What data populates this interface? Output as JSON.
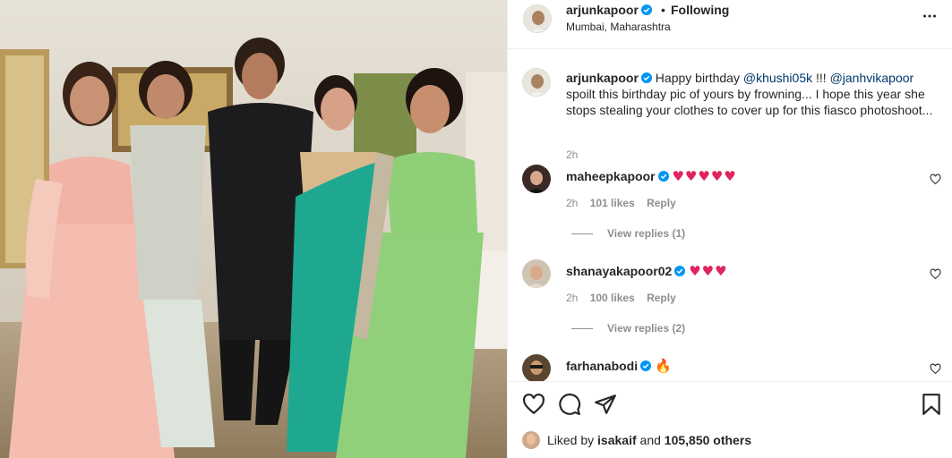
{
  "post": {
    "author": "arjunkapoor",
    "follow_status": "Following",
    "separator": "•",
    "location": "Mumbai, Maharashtra",
    "caption": {
      "username": "arjunkapoor",
      "part1": "Happy birthday ",
      "mention1": "@khushi05k",
      "part2": " !!! ",
      "mention2": "@janhvikapoor",
      "line2": "spoilt this birthday pic of yours by frowning... I hope this year she",
      "line3": "stops stealing your clothes to cover up for this fiasco photoshoot...",
      "time": "2h"
    }
  },
  "comments": [
    {
      "username": "maheepkapoor",
      "emoji": "♥♥♥♥♥",
      "time": "2h",
      "likes": "101 likes",
      "reply": "Reply",
      "replies": "View replies (1)"
    },
    {
      "username": "shanayakapoor02",
      "emoji": "♥♥♥",
      "time": "2h",
      "likes": "100 likes",
      "reply": "Reply",
      "replies": "View replies (2)"
    },
    {
      "username": "farhanabodi",
      "emoji": "🔥"
    }
  ],
  "likes": {
    "prefix": "Liked by ",
    "user": "isakaif",
    "mid": " and ",
    "count": "105,850 others"
  },
  "colors": {
    "text": "#262626",
    "secondary": "#8e8e8e",
    "mention": "#00376b",
    "verified": "#0095f6",
    "heart": "#e0245e"
  },
  "icons": [
    "verified-badge-icon",
    "more-options-icon",
    "heart-outline-icon",
    "comment-icon",
    "share-icon",
    "bookmark-icon"
  ]
}
